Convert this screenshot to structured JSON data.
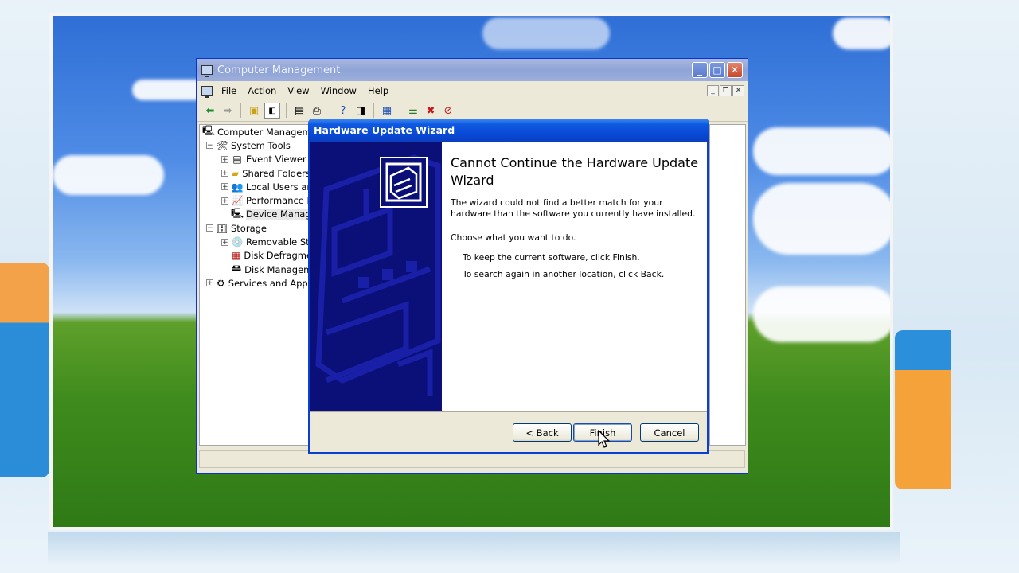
{
  "colors": {
    "xp_title_blue": "#0848d6",
    "inactive_title": "#9cafdc",
    "dialog_face": "#ece9d8",
    "wizard_side": "#0b0f78"
  },
  "computer_management": {
    "title": "Computer Management",
    "menu": [
      "File",
      "Action",
      "View",
      "Window",
      "Help"
    ],
    "window_buttons": {
      "minimize": "_",
      "maximize": "□",
      "close": "✕"
    },
    "mdi_buttons": {
      "minimize": "_",
      "restore": "❐",
      "close": "✕"
    },
    "toolbar_icons": [
      "back-arrow-icon",
      "forward-arrow-icon",
      "up-folder-icon",
      "show-hide-tree-icon",
      "properties-icon",
      "print-icon",
      "help-icon",
      "show-hide-pane-icon",
      "scan-hardware-icon",
      "update-driver-icon",
      "uninstall-icon",
      "disable-icon"
    ],
    "tree": [
      {
        "label": "Computer Management",
        "icon": "computer-icon",
        "level": 0,
        "expander": ""
      },
      {
        "label": "System Tools",
        "icon": "tools-icon",
        "level": 1,
        "expander": "−"
      },
      {
        "label": "Event Viewer",
        "icon": "event-viewer-icon",
        "level": 2,
        "expander": "+"
      },
      {
        "label": "Shared Folders",
        "icon": "shared-folders-icon",
        "level": 2,
        "expander": "+"
      },
      {
        "label": "Local Users and",
        "icon": "users-icon",
        "level": 2,
        "expander": "+"
      },
      {
        "label": "Performance Lo",
        "icon": "performance-icon",
        "level": 2,
        "expander": "+"
      },
      {
        "label": "Device Manage",
        "icon": "device-manager-icon",
        "level": 2,
        "expander": ""
      },
      {
        "label": "Storage",
        "icon": "storage-icon",
        "level": 1,
        "expander": "−"
      },
      {
        "label": "Removable Stor",
        "icon": "removable-storage-icon",
        "level": 2,
        "expander": "+"
      },
      {
        "label": "Disk Defragmer",
        "icon": "defrag-icon",
        "level": 2,
        "expander": ""
      },
      {
        "label": "Disk Manageme",
        "icon": "disk-management-icon",
        "level": 2,
        "expander": ""
      },
      {
        "label": "Services and Applic",
        "icon": "services-icon",
        "level": 1,
        "expander": "+"
      }
    ]
  },
  "wizard": {
    "title": "Hardware Update Wizard",
    "heading": "Cannot Continue the Hardware Update Wizard",
    "message": "The wizard could not find a better match for your hardware than the software you currently have installed.",
    "choose": "Choose what you want to do.",
    "option_finish": "To keep the current software, click Finish.",
    "option_back": "To search again in another location, click Back.",
    "buttons": {
      "back": "< Back",
      "finish": "Finish",
      "cancel": "Cancel"
    }
  }
}
